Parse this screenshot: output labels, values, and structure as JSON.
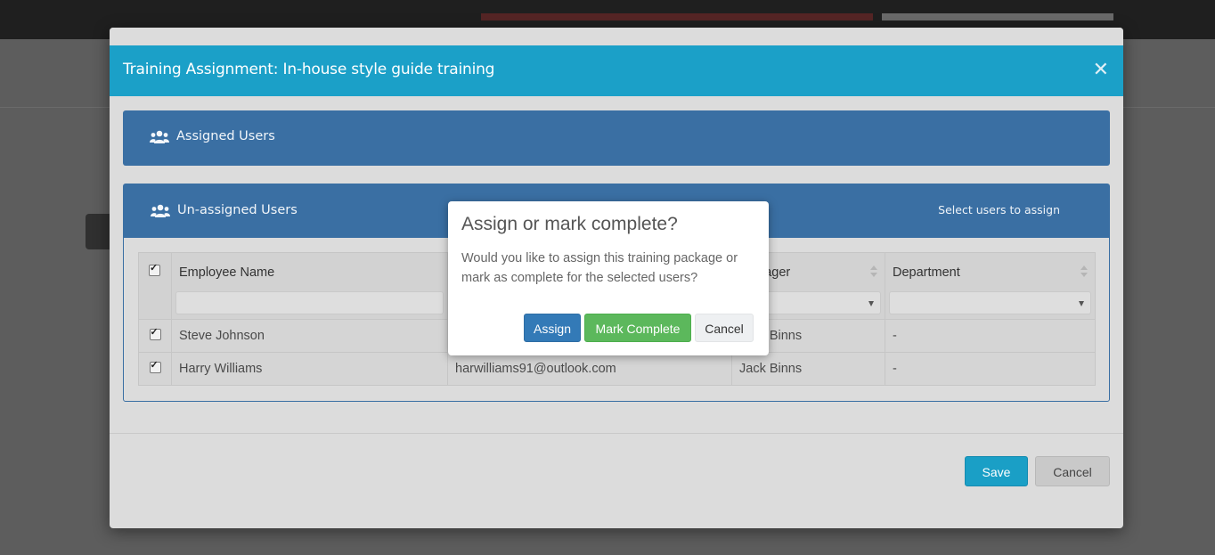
{
  "modal": {
    "title": "Training Assignment: In-house style guide training",
    "close_icon": "close-icon",
    "assigned_panel": {
      "title": "Assigned Users",
      "icon": "users-icon"
    },
    "unassigned_panel": {
      "title": "Un-assigned Users",
      "icon": "users-icon",
      "hint": "Select users to assign",
      "table": {
        "columns": [
          "Employee Name",
          "",
          "Manager",
          "Department"
        ],
        "rows": [
          {
            "selected": true,
            "name": "Steve Johnson",
            "email": "",
            "manager": "Jack Binns",
            "department": "-"
          },
          {
            "selected": true,
            "name": "Harry Williams",
            "email": "harwilliams91@outlook.com",
            "manager": "Jack Binns",
            "department": "-"
          }
        ]
      }
    },
    "footer": {
      "save_label": "Save",
      "cancel_label": "Cancel"
    }
  },
  "confirm": {
    "title": "Assign or mark complete?",
    "body": "Would you like to assign this training package or mark as complete for the selected users?",
    "assign_label": "Assign",
    "complete_label": "Mark Complete",
    "cancel_label": "Cancel"
  },
  "colors": {
    "header": "#1ba0c8",
    "panel": "#3a6fa3",
    "assign": "#337ab7",
    "complete": "#5cb85c"
  }
}
